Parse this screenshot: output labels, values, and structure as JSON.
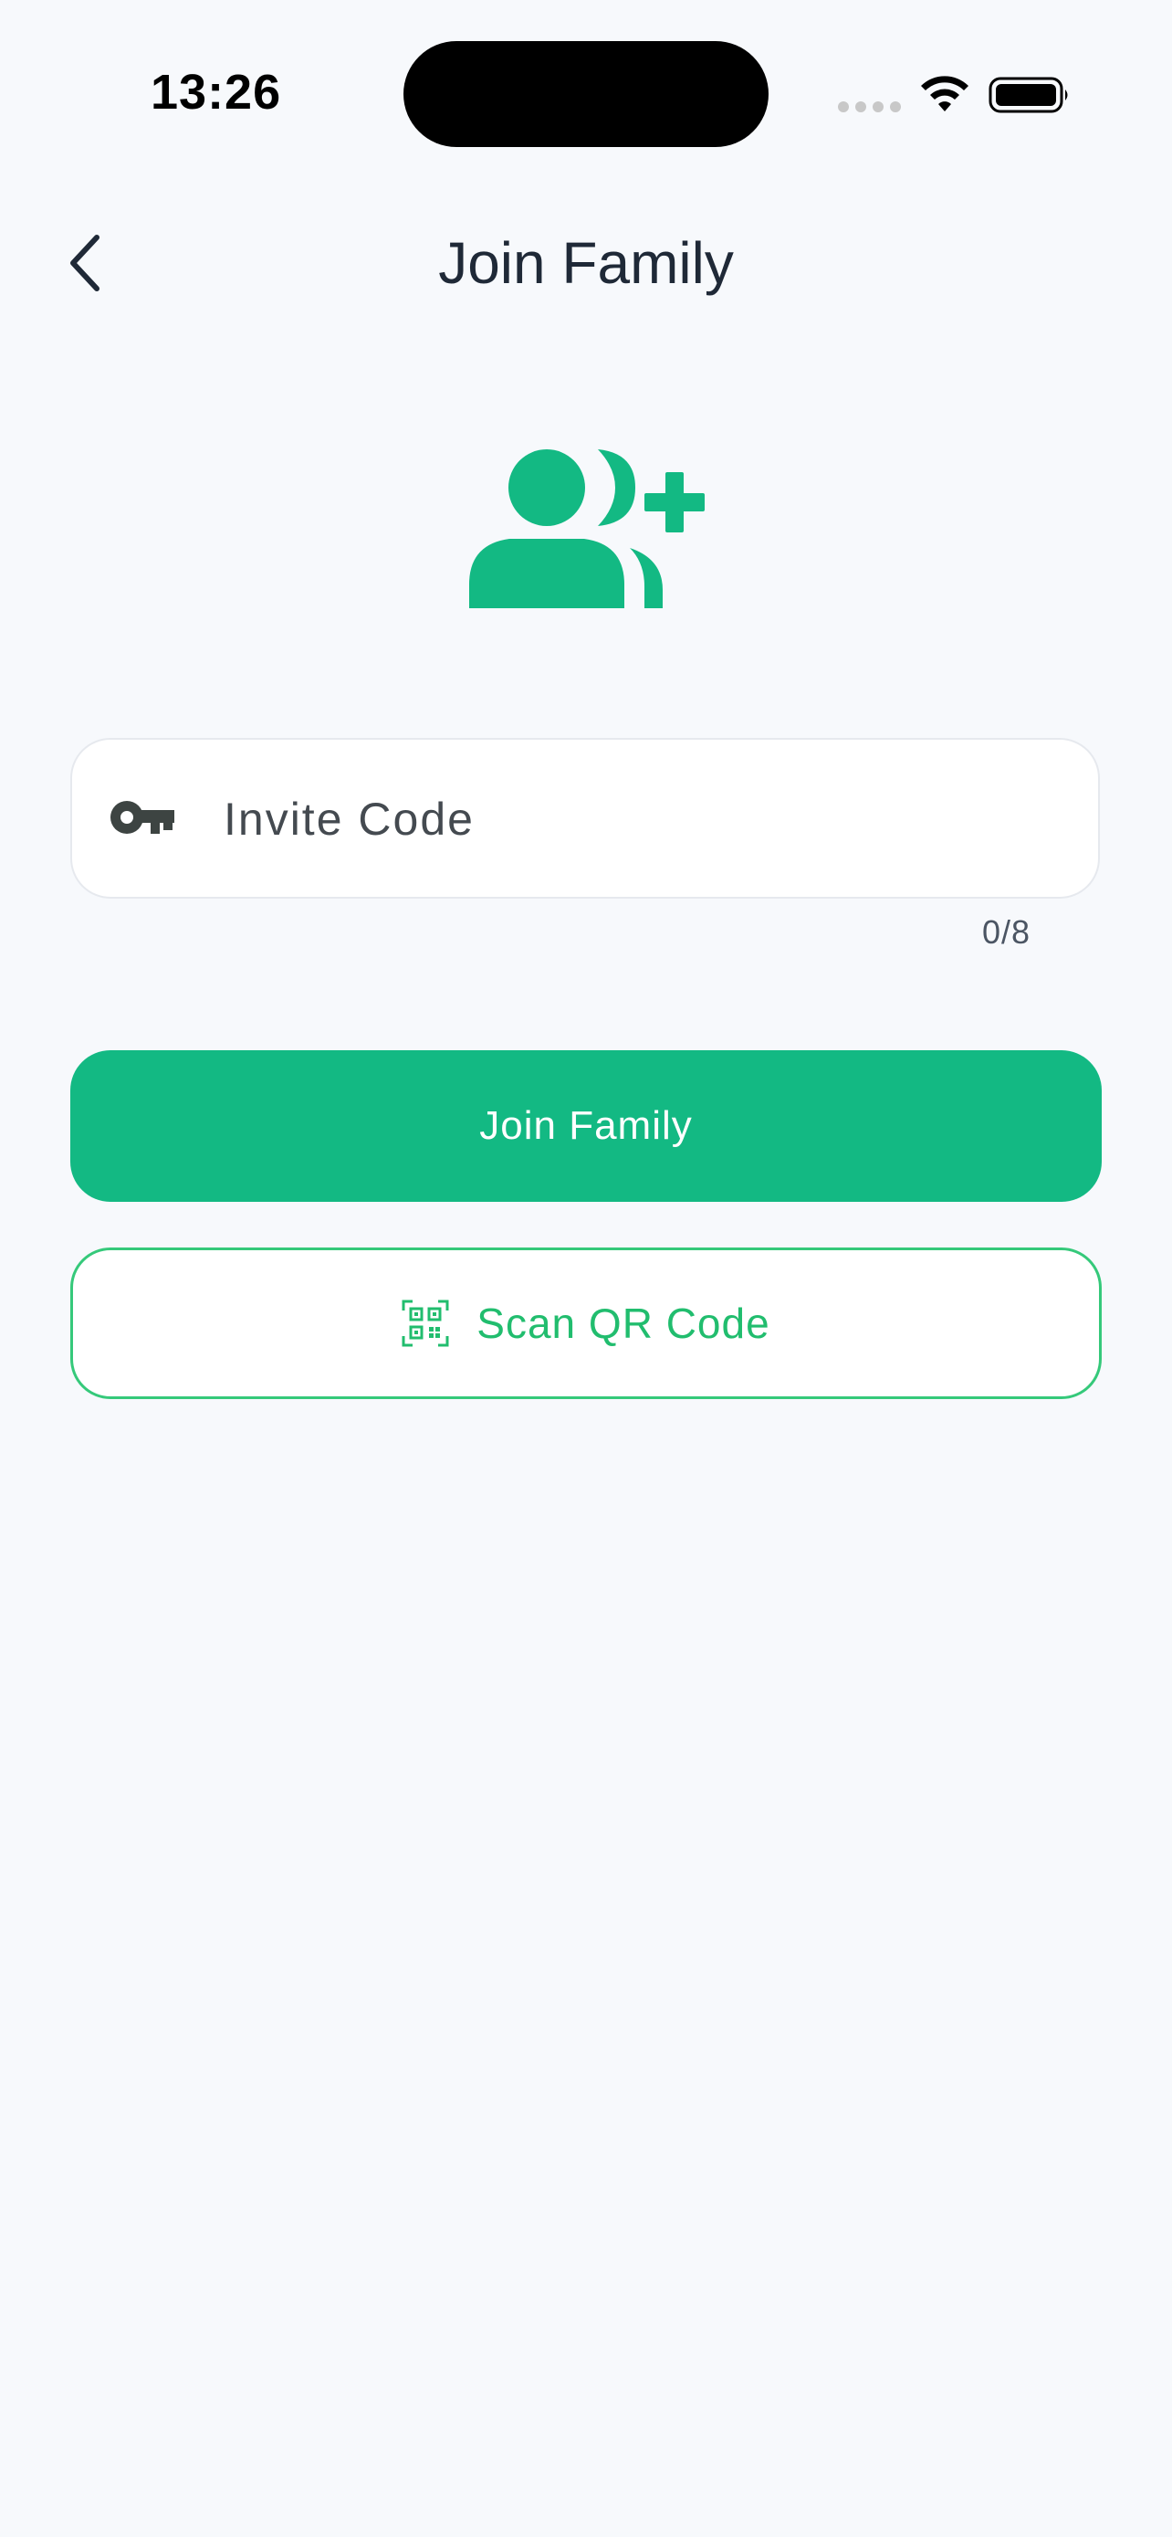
{
  "status_bar": {
    "time": "13:26"
  },
  "header": {
    "title": "Join Family",
    "back_icon": "chevron-left-icon"
  },
  "hero": {
    "icon": "add-group-icon",
    "color": "#13b983"
  },
  "invite_field": {
    "icon": "key-icon",
    "placeholder": "Invite Code",
    "value": "",
    "counter": "0/8"
  },
  "actions": {
    "join_label": "Join Family",
    "scan_label": "Scan QR Code",
    "scan_icon": "qr-code-icon"
  },
  "colors": {
    "accent": "#13b983",
    "outline_accent": "#35c97a",
    "background": "#f7f9fc",
    "title": "#1f2937"
  }
}
